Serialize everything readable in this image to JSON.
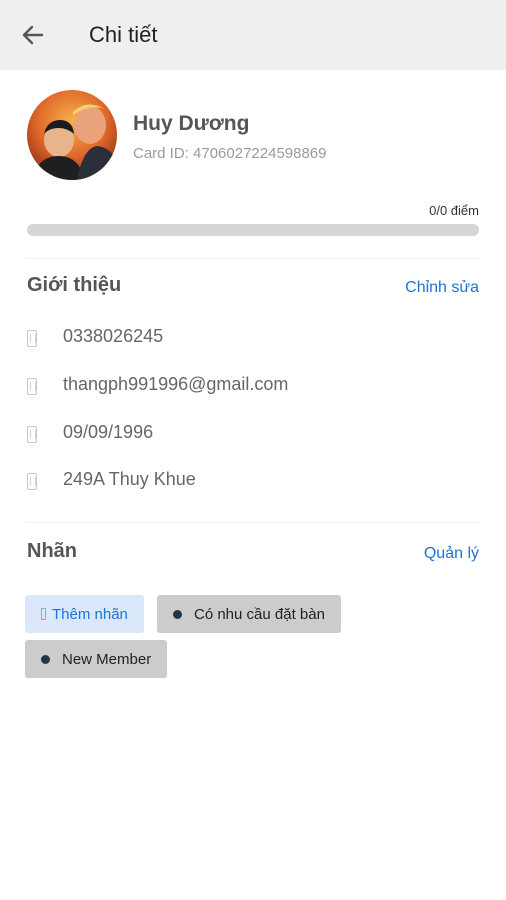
{
  "appbar": {
    "title": "Chi tiết",
    "back_icon": "arrow-left-icon"
  },
  "profile": {
    "name": "Huy Dương",
    "card_id": "Card ID: 4706027224598869",
    "points": "0/0 điểm",
    "progress_fraction": 0
  },
  "intro": {
    "title": "Giới thiệu",
    "edit_label": "Chỉnh sửa",
    "items": [
      {
        "icon": "phone-icon",
        "text": "0338026245"
      },
      {
        "icon": "email-icon",
        "text": "thangph991996@gmail.com"
      },
      {
        "icon": "calendar-icon",
        "text": "09/09/1996"
      },
      {
        "icon": "location-icon",
        "text": "249A Thuy Khue"
      }
    ]
  },
  "labels": {
    "title": "Nhãn",
    "manage_label": "Quản lý",
    "add_label": "Thêm nhãn",
    "tags": [
      "Có nhu cầu đặt bàn",
      "New Member"
    ],
    "accent_color": "#1d73d8",
    "tag_dot_color": "#1e3a4a"
  }
}
